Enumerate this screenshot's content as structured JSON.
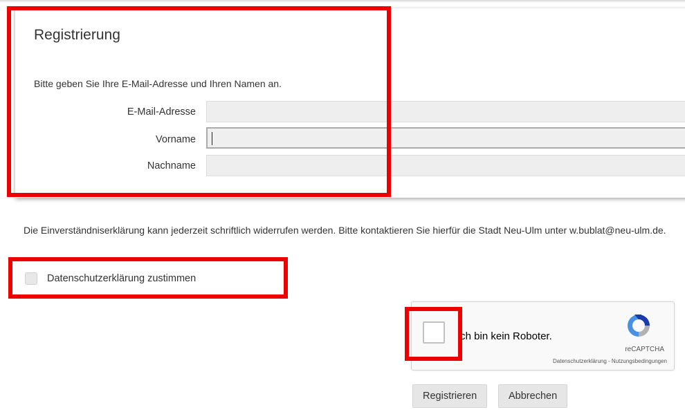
{
  "form": {
    "title": "Registrierung",
    "intro": "Bitte geben Sie Ihre E-Mail-Adresse und Ihren Namen an.",
    "fields": [
      {
        "label": "E-Mail-Adresse",
        "value": ""
      },
      {
        "label": "Vorname",
        "value": ""
      },
      {
        "label": "Nachname",
        "value": ""
      }
    ]
  },
  "consent": {
    "text": "Die Einverständniserklärung kann jederzeit schriftlich widerrufen werden. Bitte kontaktieren Sie hierfür die Stadt Neu-Ulm unter w.bublat@neu-ulm.de.",
    "checkbox_label": "Datenschutzerklärung zustimmen",
    "checked": false
  },
  "recaptcha": {
    "label": "Ich bin kein Roboter.",
    "brand": "reCAPTCHA",
    "links": "Datenschutzerklärung - Nutzungsbedingungen"
  },
  "buttons": {
    "register": "Registrieren",
    "cancel": "Abbrechen"
  },
  "colors": {
    "highlight": "#ee0000",
    "recaptcha_blue": "#1c3aa9",
    "recaptcha_light": "#4a90e2",
    "recaptcha_gray": "#b1b1b1"
  }
}
